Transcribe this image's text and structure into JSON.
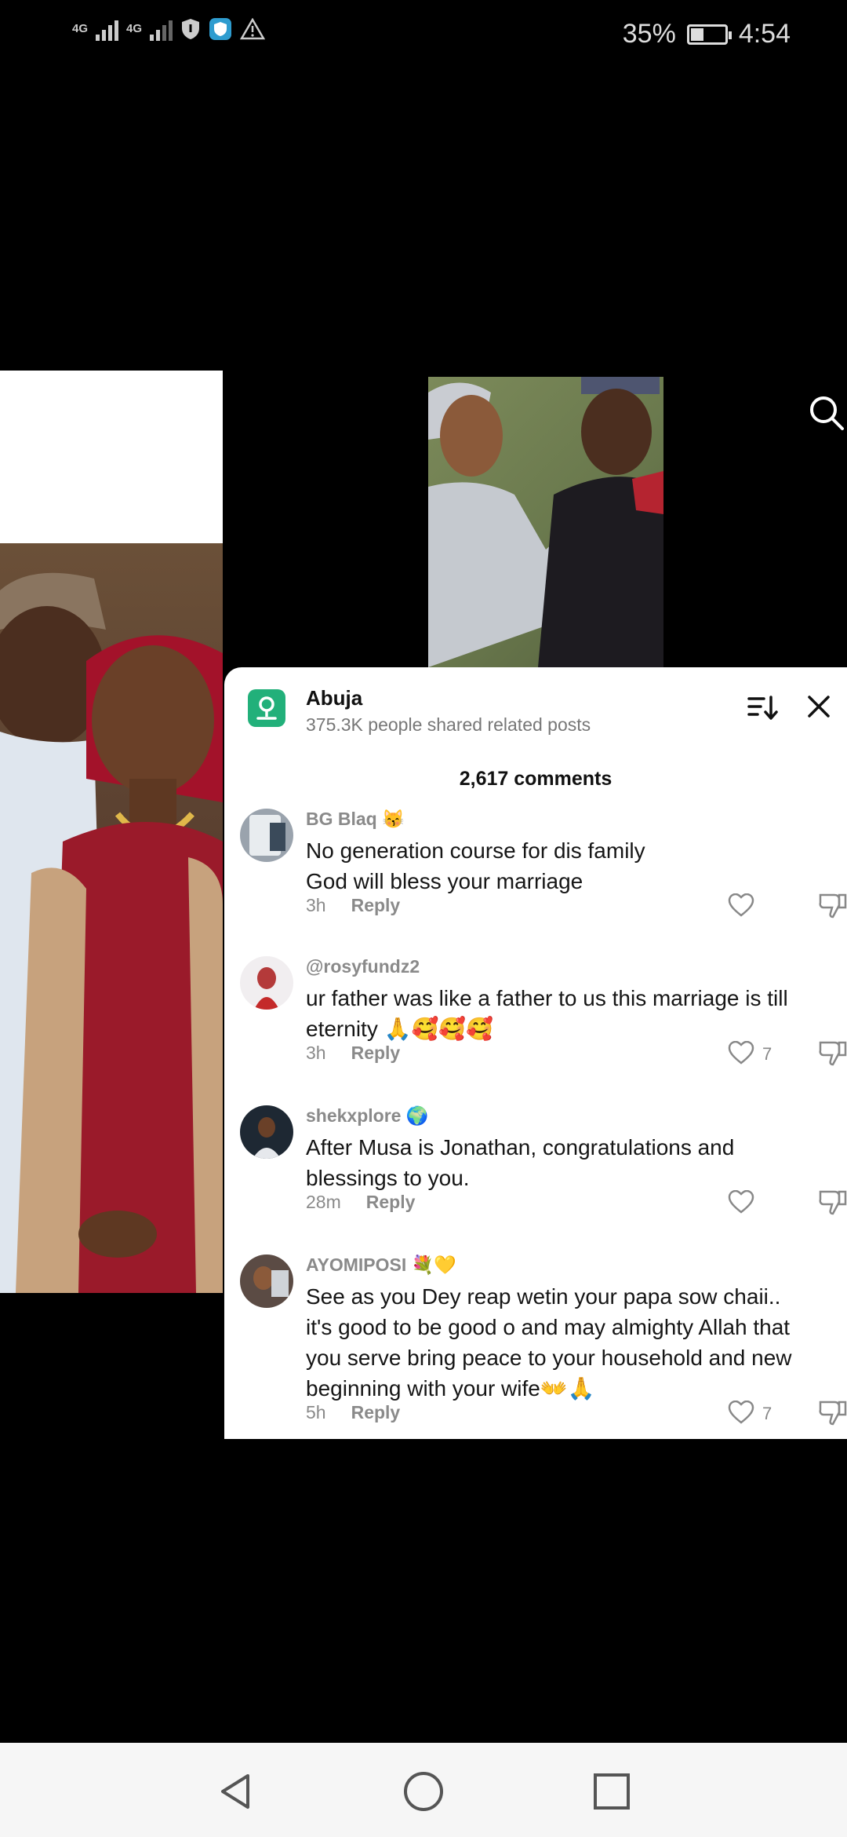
{
  "status_bar": {
    "network1": "4G",
    "network2": "4G",
    "battery_percent": "35%",
    "battery_level": 0.35,
    "time": "4:54"
  },
  "location": {
    "title": "Abuja",
    "subtitle": "375.3K people shared related posts"
  },
  "comments_count": "2,617 comments",
  "comments": [
    {
      "username": "BG Blaq",
      "emoji": "😽",
      "text_lines": [
        "No generation course for dis family",
        "God will bless your marriage"
      ],
      "time": "3h",
      "reply": "Reply",
      "likes": ""
    },
    {
      "username": "@rosyfundz2",
      "emoji": "",
      "text_lines": [
        "ur father was like a father to us this marriage is till",
        "eternity 🙏🥰🥰🥰"
      ],
      "time": "3h",
      "reply": "Reply",
      "likes": "7"
    },
    {
      "username": "shekxplore",
      "emoji": "🌍",
      "text_lines": [
        "After Musa is Jonathan, congratulations and",
        "blessings to you."
      ],
      "time": "28m",
      "reply": "Reply",
      "likes": ""
    },
    {
      "username": "AYOMIPOSI",
      "emoji": "💐💛",
      "text_lines": [
        "See as you Dey reap wetin your papa sow chaii..",
        "it's good to be good o and may almighty Allah that",
        "you serve bring peace to your household and new",
        "beginning with your wife👐🙏"
      ],
      "time": "5h",
      "reply": "Reply",
      "likes": "7"
    }
  ],
  "icons": {
    "search": "search-icon",
    "sort": "sort-icon",
    "close": "close-icon",
    "heart": "heart-icon",
    "dislike": "dislike-icon",
    "back": "back-icon",
    "home": "home-icon",
    "recents": "recents-icon"
  },
  "colors": {
    "location_icon": "#22b07a",
    "background": "#000000",
    "sheet": "#ffffff"
  }
}
